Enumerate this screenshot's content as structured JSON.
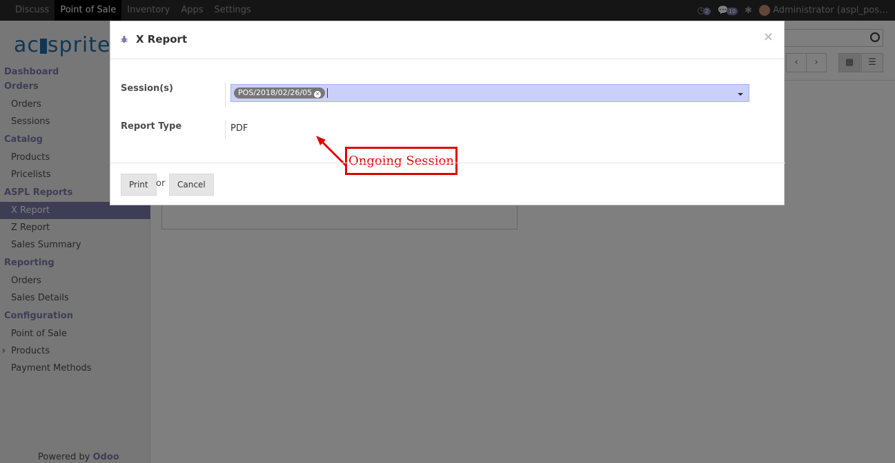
{
  "topbar": {
    "menu": [
      "Discuss",
      "Point of Sale",
      "Inventory",
      "Apps",
      "Settings"
    ],
    "active": "Point of Sale",
    "activity_count": "2",
    "messages_count": "10",
    "user": "Administrator (aspl_pos…"
  },
  "sidebar": {
    "logo": "ac sprite",
    "sections": [
      {
        "title": "Dashboard",
        "items": []
      },
      {
        "title": "Orders",
        "items": [
          "Orders",
          "Sessions"
        ]
      },
      {
        "title": "Catalog",
        "items": [
          "Products",
          "Pricelists"
        ]
      },
      {
        "title": "ASPL Reports",
        "items": [
          "X Report",
          "Z Report",
          "Sales Summary"
        ]
      },
      {
        "title": "Reporting",
        "items": [
          "Orders",
          "Sales Details"
        ]
      },
      {
        "title": "Configuration",
        "items": [
          "Point of Sale",
          "Products",
          "Payment Methods"
        ]
      }
    ],
    "active_item": "X Report",
    "powered_prefix": "Powered by",
    "powered_brand": "Odoo"
  },
  "modal": {
    "title": "X Report",
    "close_symbol": "×",
    "fields": {
      "sessions_label": "Session(s)",
      "session_tag": "POS/2018/02/26/05",
      "report_type_label": "Report Type",
      "report_type_value": "PDF"
    },
    "annotation": "Ongoing Session",
    "footer": {
      "print_label": "Print",
      "or_label": "or",
      "cancel_label": "Cancel"
    }
  },
  "colors": {
    "accent": "#7c7bad",
    "annotation": "#e00000",
    "selected_field": "#cbd0fa"
  }
}
